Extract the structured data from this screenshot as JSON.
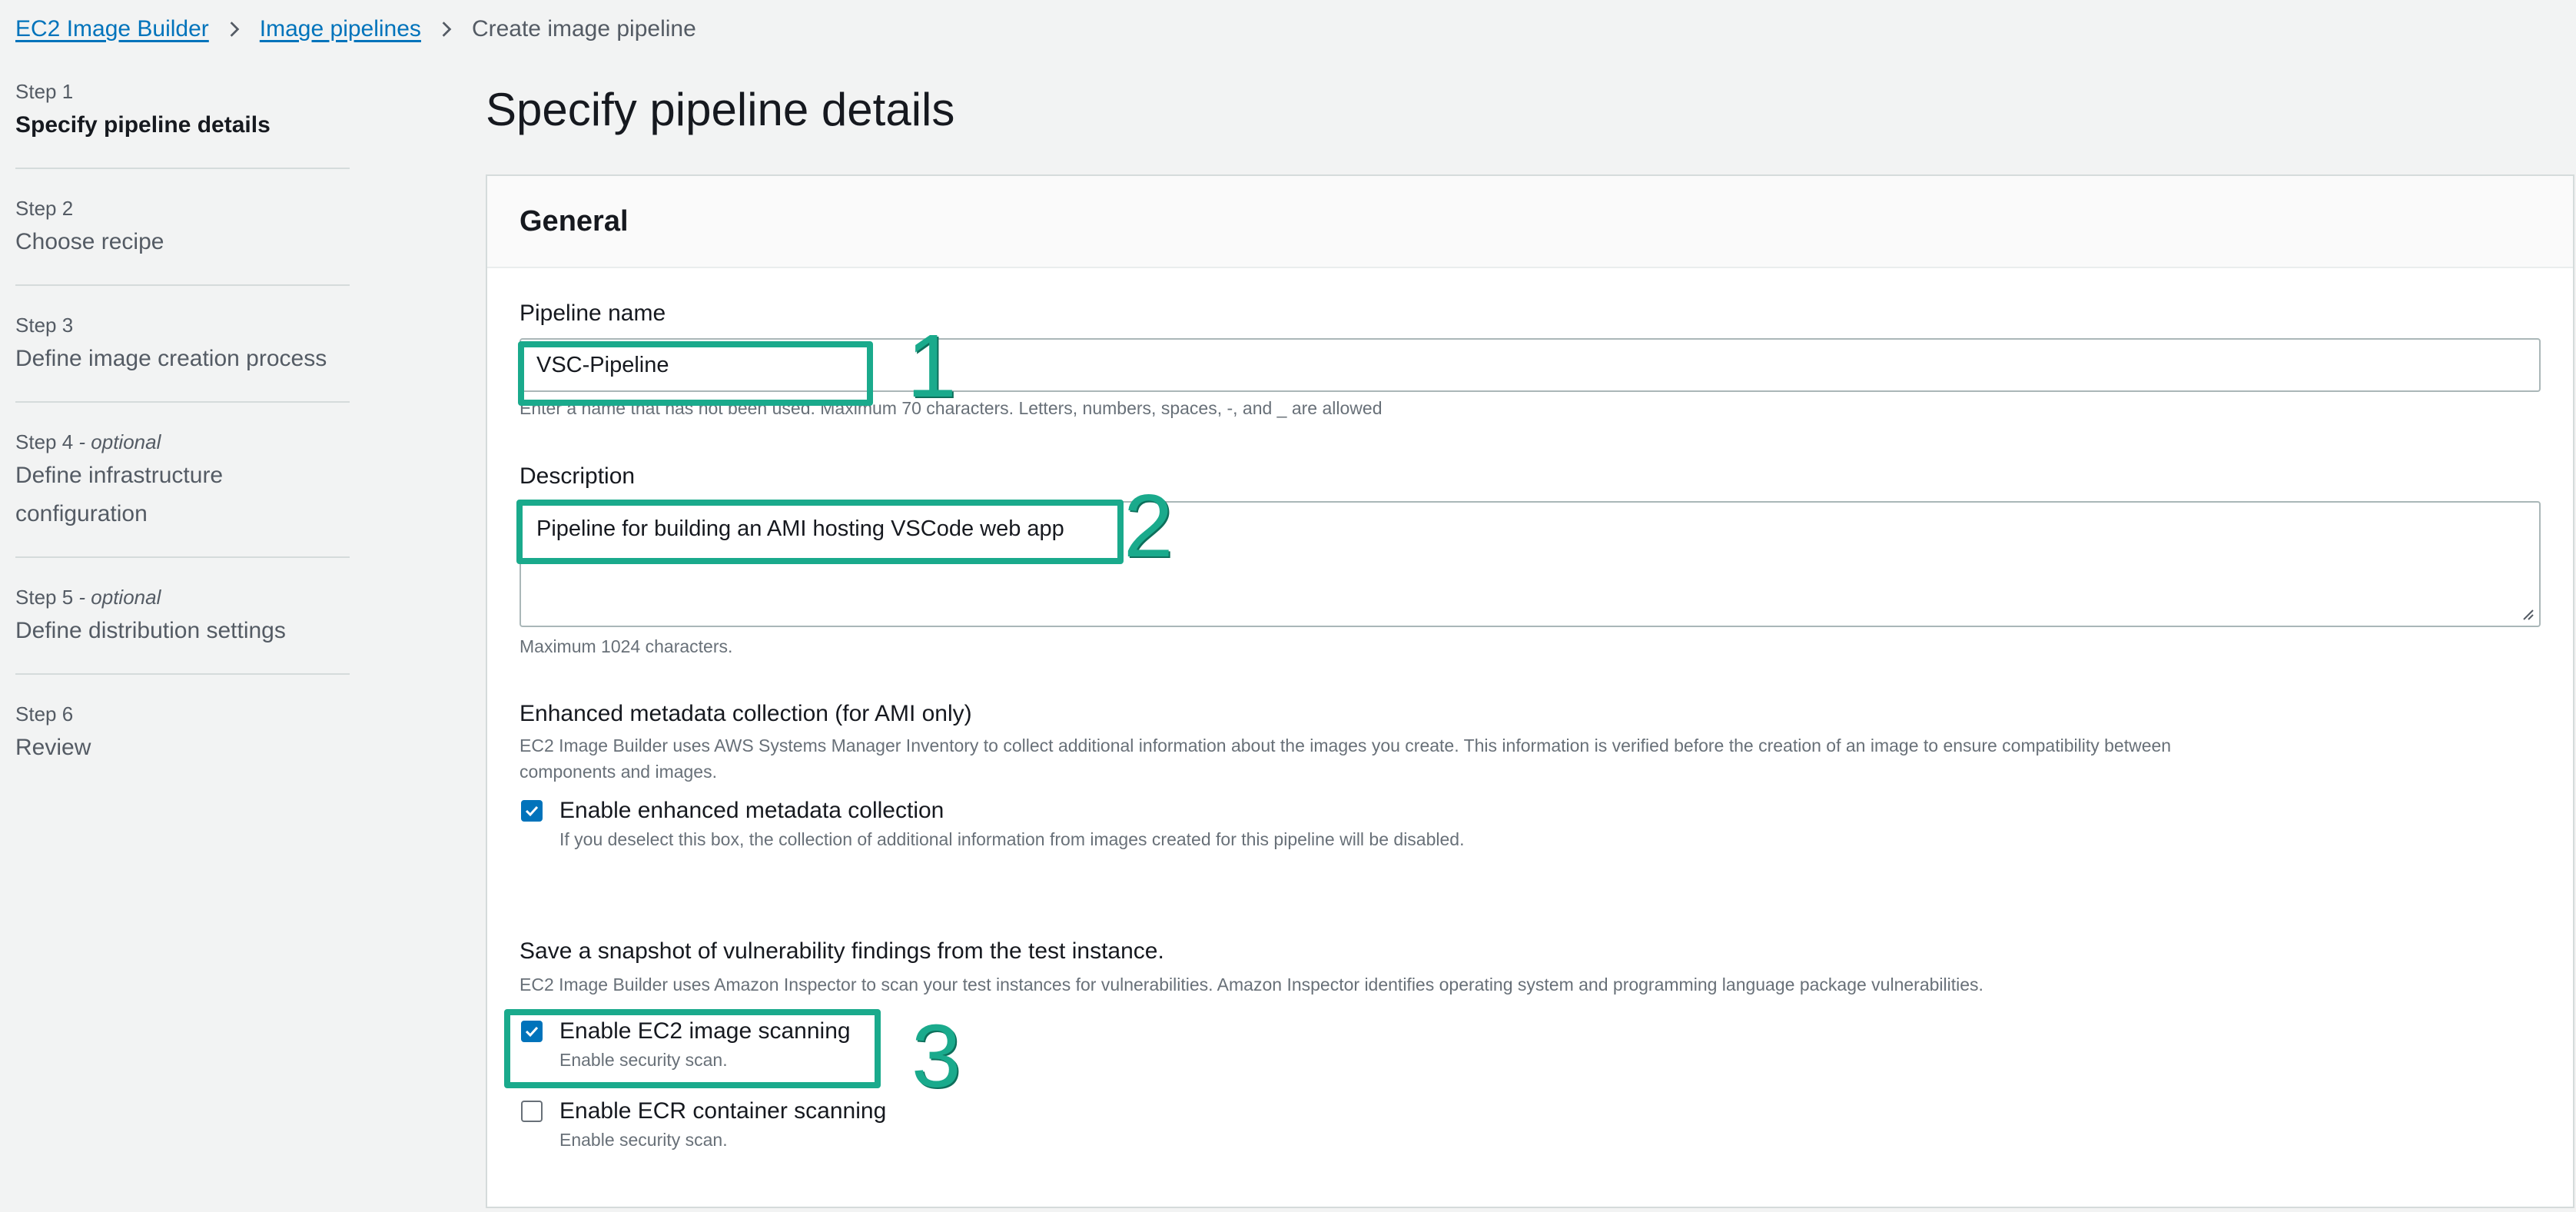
{
  "breadcrumb": {
    "items": [
      "EC2 Image Builder",
      "Image pipelines"
    ],
    "current": "Create image pipeline"
  },
  "steps": [
    {
      "num": "Step 1",
      "optional": "",
      "title": "Specify pipeline details"
    },
    {
      "num": "Step 2",
      "optional": "",
      "title": "Choose recipe"
    },
    {
      "num": "Step 3",
      "optional": "",
      "title": "Define image creation process"
    },
    {
      "num": "Step 4",
      "optional": " - optional",
      "title_line1": "Define infrastructure",
      "title_line2": "configuration"
    },
    {
      "num": "Step 5",
      "optional": " - optional",
      "title": "Define distribution settings"
    },
    {
      "num": "Step 6",
      "optional": "",
      "title": "Review"
    }
  ],
  "page_title": "Specify pipeline details",
  "general": {
    "title": "General",
    "pipeline_name": {
      "label": "Pipeline name",
      "value": "VSC-Pipeline",
      "hint": "Enter a name that has not been used. Maximum 70 characters. Letters, numbers, spaces, -, and _ are allowed"
    },
    "description": {
      "label": "Description",
      "value": "Pipeline for building an AMI hosting VSCode web app",
      "hint": "Maximum 1024 characters."
    },
    "metadata": {
      "heading": "Enhanced metadata collection (for AMI only)",
      "desc_line1": "EC2 Image Builder uses AWS Systems Manager Inventory to collect additional information about the images you create. This information is verified before the creation of an image to ensure compatibility between",
      "desc_line2": "components and images.",
      "checkbox_label": "Enable enhanced metadata collection",
      "checkbox_desc": "If you deselect this box, the collection of additional information from images created for this pipeline will be disabled.",
      "checked": true
    },
    "scanning": {
      "heading": "Save a snapshot of vulnerability findings from the test instance.",
      "desc": "EC2 Image Builder uses Amazon Inspector to scan your test instances for vulnerabilities. Amazon Inspector identifies operating system and programming language package vulnerabilities.",
      "ec2_label": "Enable EC2 image scanning",
      "ec2_desc": "Enable security scan.",
      "ec2_checked": true,
      "ecr_label": "Enable ECR container scanning",
      "ecr_desc": "Enable security scan.",
      "ecr_checked": false
    }
  },
  "annotations": [
    "1",
    "2",
    "3"
  ],
  "colors": {
    "link": "#0073bb",
    "checkbox": "#0073bb",
    "annotation": "#1aaa8c",
    "background": "#f2f3f3"
  }
}
